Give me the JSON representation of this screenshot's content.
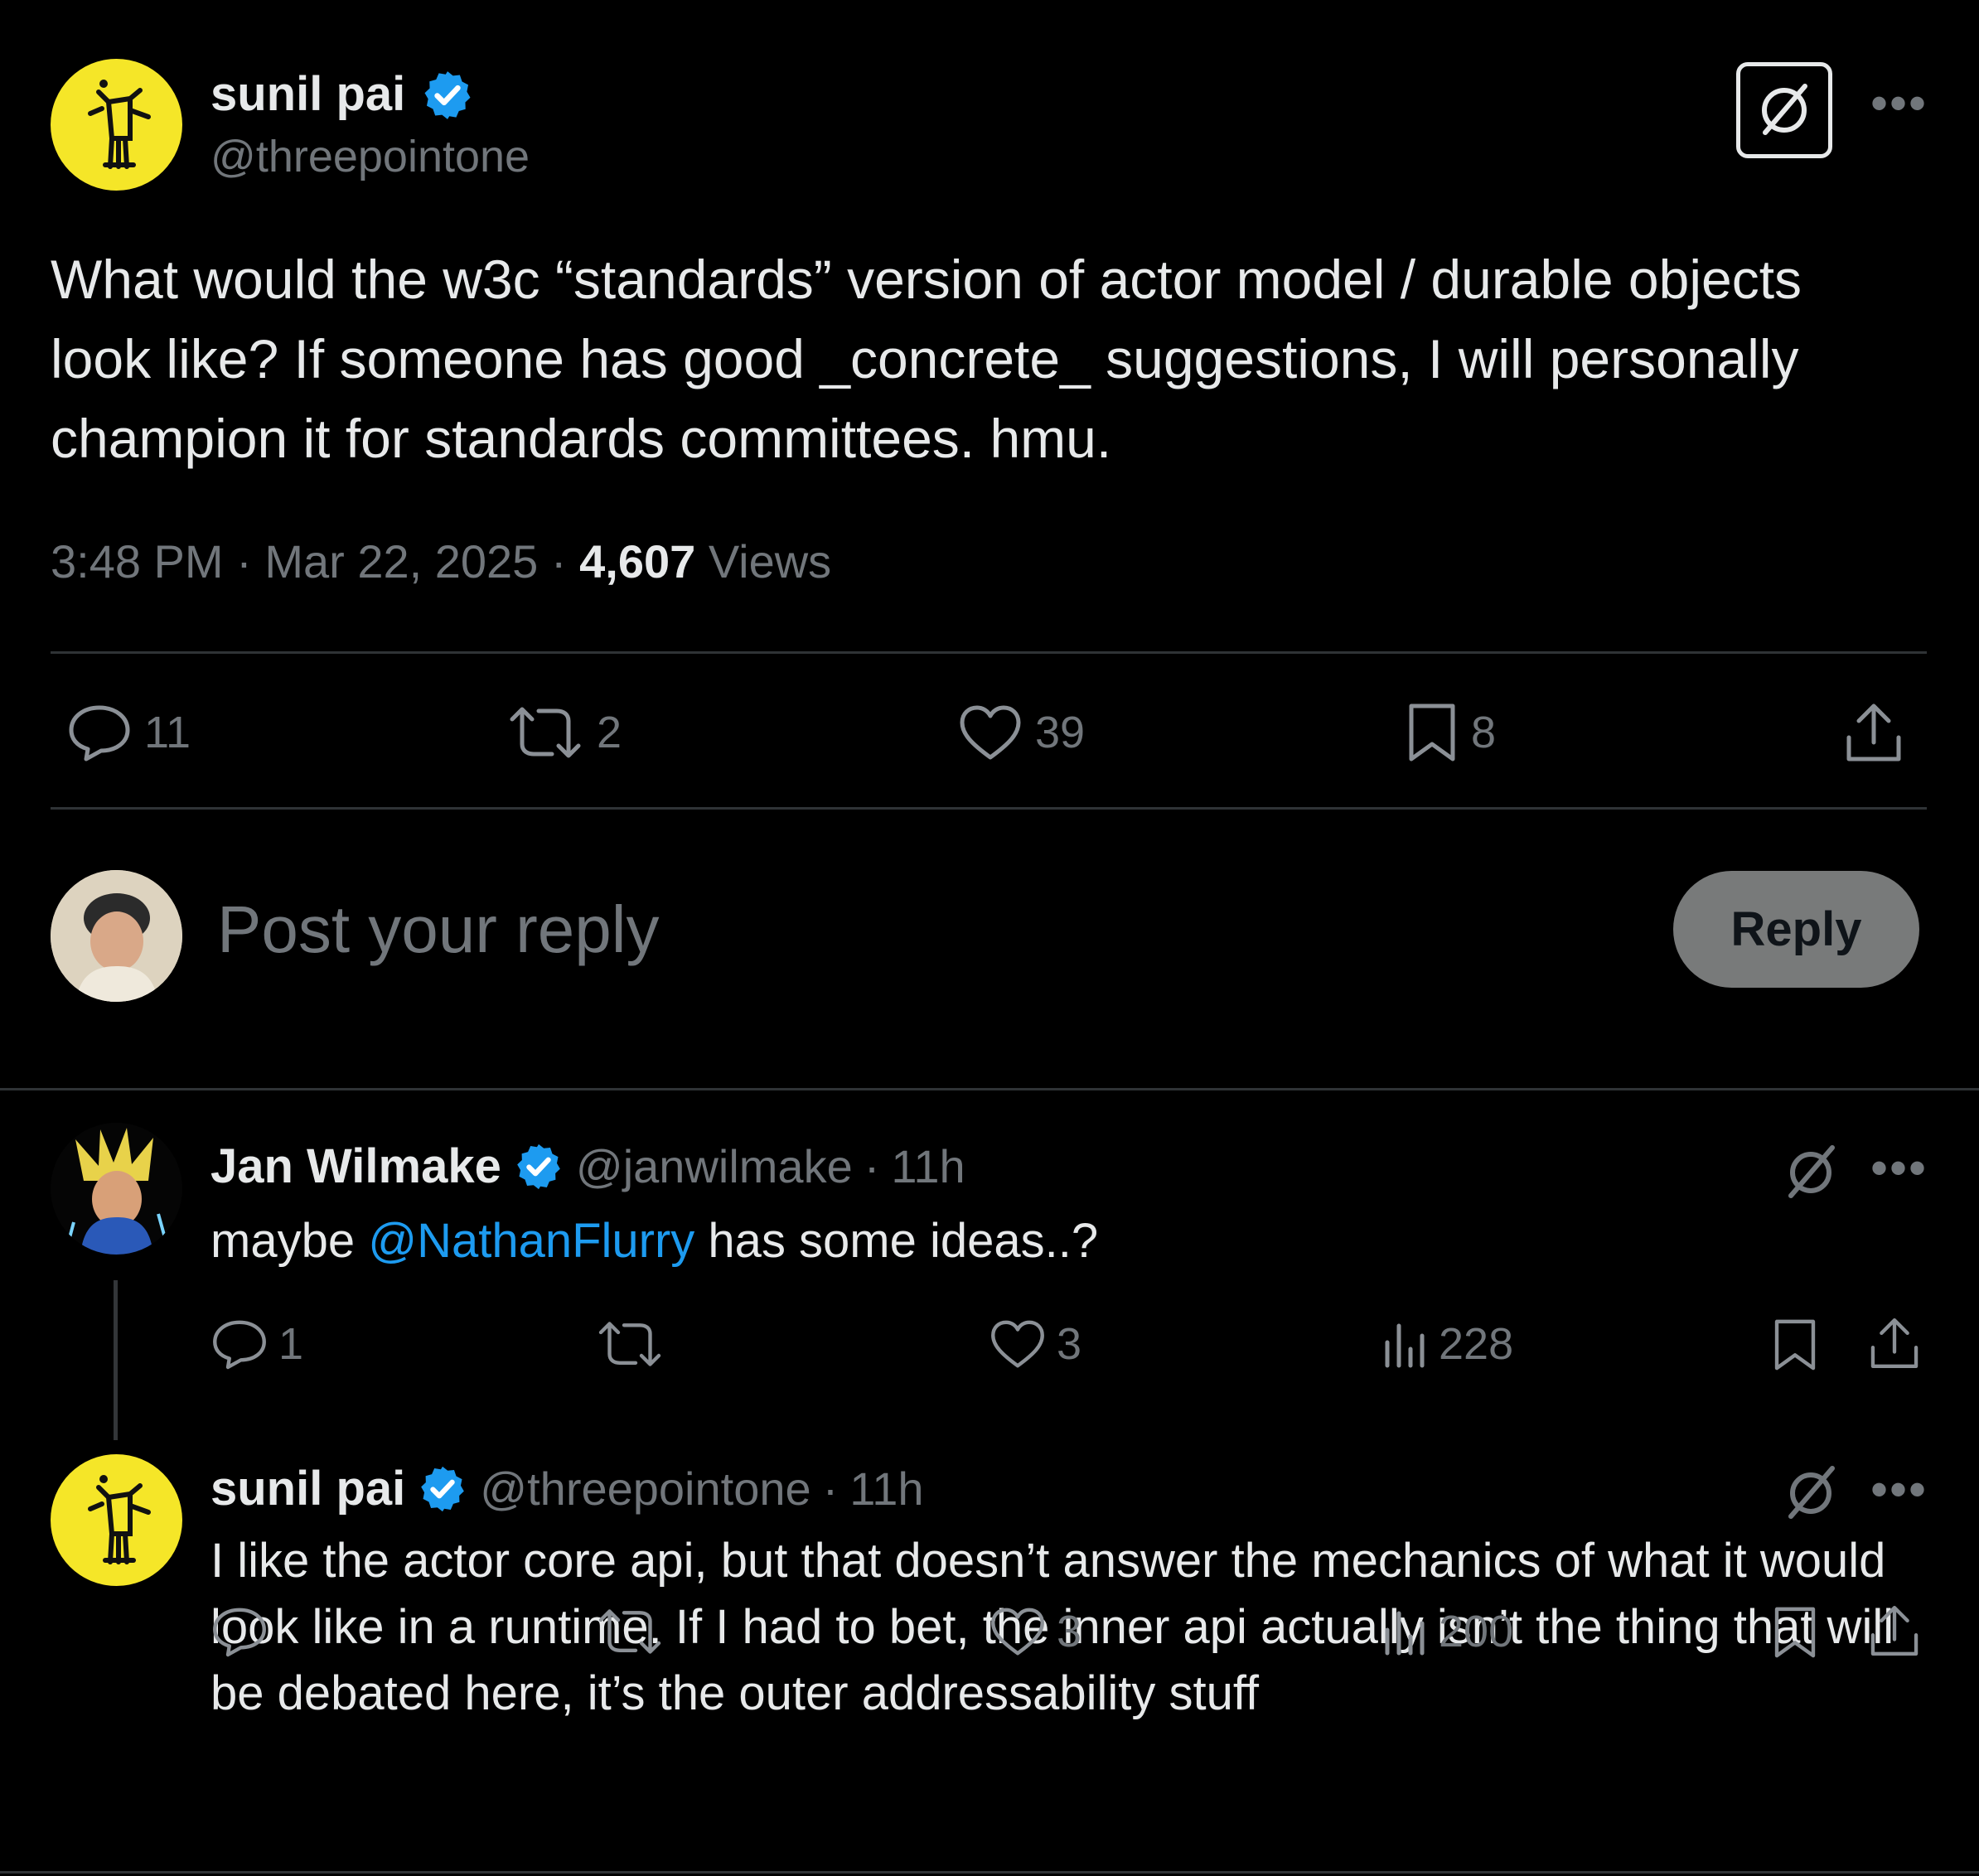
{
  "post": {
    "author_name": "sunil pai",
    "author_handle": "@threepointone",
    "text": "What would the w3c “standards” version of actor model / durable objects look like? If someone has good _concrete_ suggestions, I will personally champion it for standards committees. hmu.",
    "time": "3:48 PM",
    "date": "Mar 22, 2025",
    "views_count": "4,607",
    "views_label": "Views",
    "replies": "11",
    "reposts": "2",
    "likes": "39",
    "bookmarks": "8"
  },
  "composer": {
    "placeholder": "Post your reply",
    "reply_button": "Reply"
  },
  "replies": [
    {
      "author_name": "Jan Wilmake",
      "author_handle": "@janwilmake",
      "age": "11h",
      "text_before": "maybe ",
      "mention": "@NathanFlurry",
      "text_after": " has some ideas..?",
      "replies": "1",
      "reposts": "",
      "likes": "3",
      "views": "228"
    },
    {
      "author_name": "sunil pai",
      "author_handle": "@threepointone",
      "age": "11h",
      "text": "I like the actor core api, but that doesn’t answer the mechanics of what it would look like in a runtime. If I had to bet, the inner api actually isn’t the thing that will be debated here, it’s the outer addressability stuff",
      "replies": "",
      "reposts": "",
      "likes": "3",
      "views": "200"
    }
  ],
  "colors": {
    "background": "#000000",
    "text": "#e7e9ea",
    "muted": "#71767b",
    "verified": "#1d9bf0",
    "link": "#1d9bf0",
    "divider": "#2f3336",
    "avatar_yellow": "#f5e628"
  }
}
